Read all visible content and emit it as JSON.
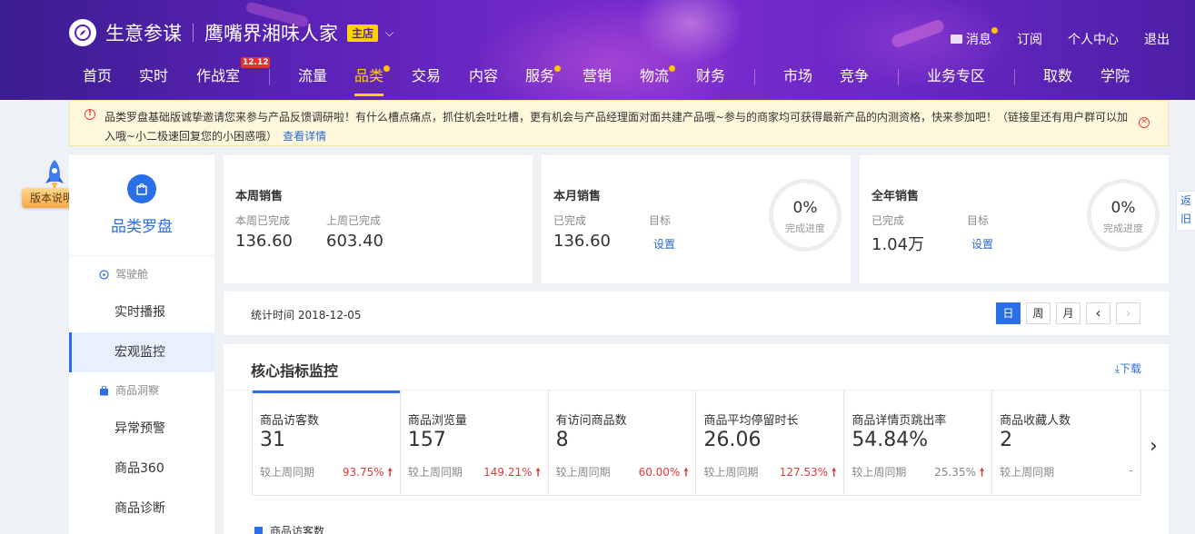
{
  "brand": {
    "name": "生意参谋",
    "shop_name": "鹰嘴界湘味人家",
    "shop_badge": "主店",
    "dropdown": "⌵"
  },
  "top_links": {
    "message": "消息",
    "subscribe": "订阅",
    "personal": "个人中心",
    "logout": "退出"
  },
  "nav": {
    "items": [
      {
        "label": "首页"
      },
      {
        "label": "实时"
      },
      {
        "label": "作战室",
        "badge": "12.12"
      },
      {
        "label": "流量"
      },
      {
        "label": "品类"
      },
      {
        "label": "交易"
      },
      {
        "label": "内容"
      },
      {
        "label": "服务"
      },
      {
        "label": "营销"
      },
      {
        "label": "物流"
      },
      {
        "label": "财务"
      },
      {
        "label": "市场"
      },
      {
        "label": "竞争"
      },
      {
        "label": "业务专区"
      },
      {
        "label": "取数"
      },
      {
        "label": "学院"
      }
    ],
    "active": "品类"
  },
  "notice": {
    "text": "品类罗盘基础版诚挚邀请您来参与产品反馈调研啦！有什么槽点痛点，抓住机会吐吐槽，更有机会与产品经理面对面共建产品哦~参与的商家均可获得最新产品的内测资格，快来参加吧！（链接里还有用户群可以加入哦~小二极速回复您的小困惑哦）",
    "link": "查看详情"
  },
  "version_button": "版本说明",
  "sidebar": {
    "title": "品类罗盘",
    "groups": [
      {
        "label": "驾驶舱",
        "items": [
          "实时播报",
          "宏观监控"
        ]
      },
      {
        "label": "商品洞察",
        "items": [
          "异常预警",
          "商品360",
          "商品诊断"
        ]
      }
    ],
    "active_item": "宏观监控"
  },
  "cards": {
    "week": {
      "title": "本周销售",
      "done_label": "本周已完成",
      "done_value": "136.60",
      "last_label": "上周已完成",
      "last_value": "603.40"
    },
    "month": {
      "title": "本月销售",
      "done_label": "已完成",
      "done_value": "136.60",
      "target_label": "目标",
      "target_link": "设置",
      "pct": "0%",
      "pct_label": "完成进度"
    },
    "year": {
      "title": "全年销售",
      "done_label": "已完成",
      "done_value": "1.04万",
      "target_label": "目标",
      "target_link": "设置",
      "pct": "0%",
      "pct_label": "完成进度"
    }
  },
  "side_tip": "返旧",
  "date_bar": {
    "text": "统计时间 2018-12-05",
    "periods": [
      "日",
      "周",
      "月"
    ],
    "active_period": "日",
    "prev": "‹",
    "next": "›"
  },
  "core": {
    "title": "核心指标监控",
    "download": "下载",
    "compare_label": "较上周同期",
    "metrics": [
      {
        "name": "商品访客数",
        "value": "31",
        "change": "93.75%",
        "trend": "up"
      },
      {
        "name": "商品浏览量",
        "value": "157",
        "change": "149.21%",
        "trend": "up"
      },
      {
        "name": "有访问商品数",
        "value": "8",
        "change": "60.00%",
        "trend": "up"
      },
      {
        "name": "商品平均停留时长",
        "value": "26.06",
        "change": "127.53%",
        "trend": "up"
      },
      {
        "name": "商品详情页跳出率",
        "value": "54.84%",
        "change": "25.35%",
        "trend": "up"
      },
      {
        "name": "商品收藏人数",
        "value": "2",
        "change": "-",
        "trend": "none"
      }
    ],
    "legend": "商品访客数"
  },
  "colors": {
    "accent": "#2a6ee8",
    "header": "#5a22b6",
    "highlight": "#ffd200",
    "up": "#e23a3a"
  }
}
